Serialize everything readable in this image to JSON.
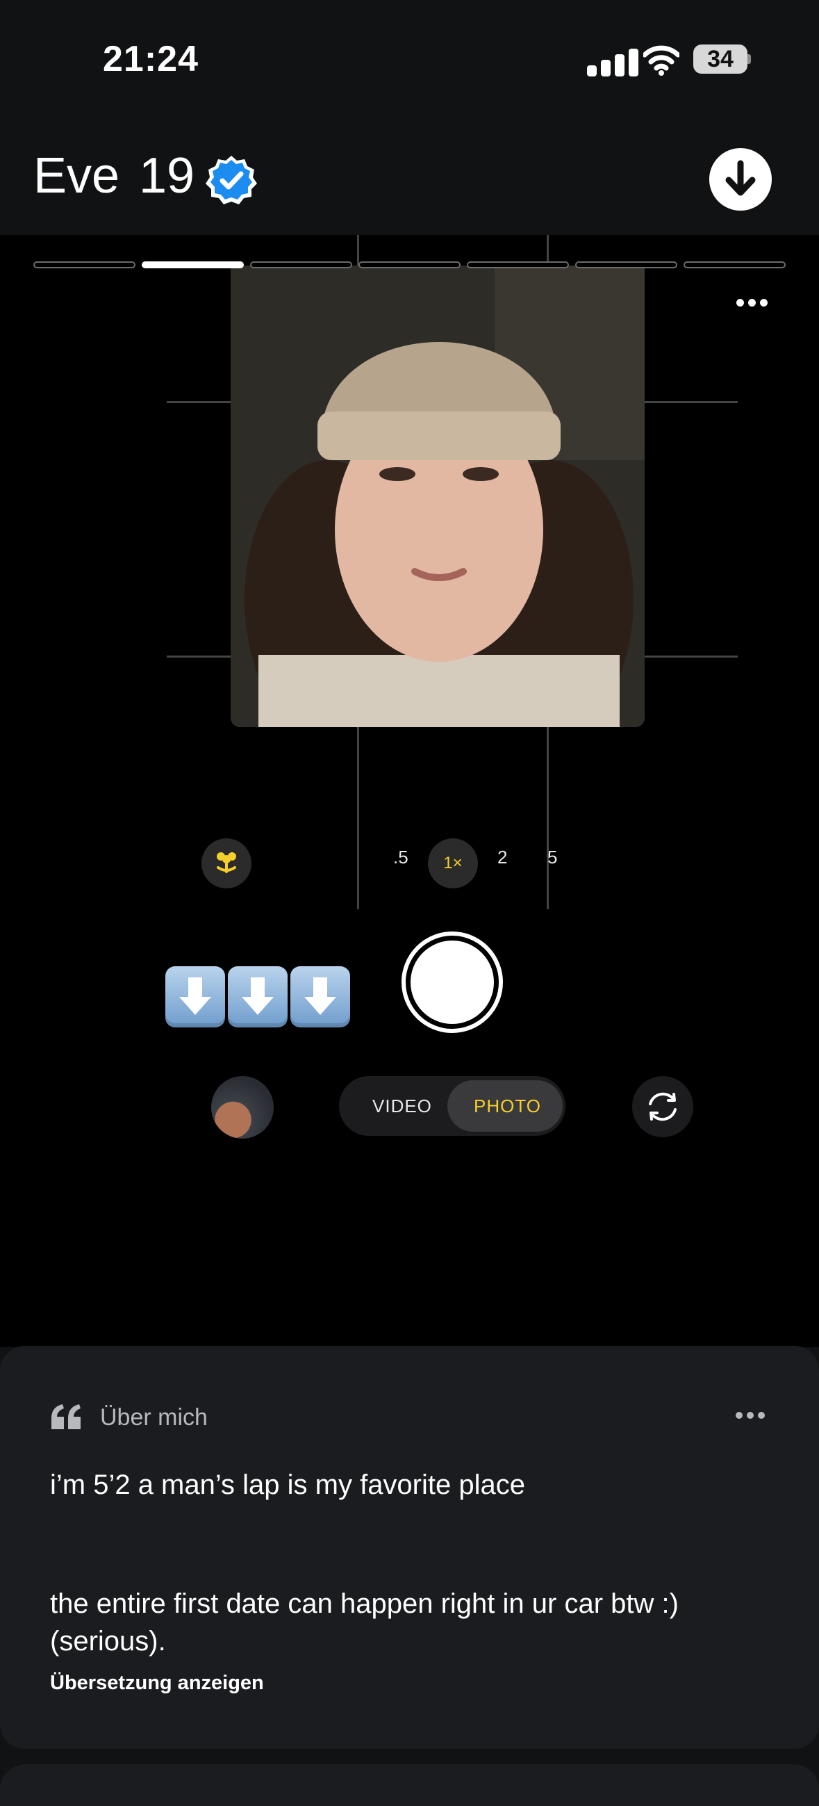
{
  "status_bar": {
    "time": "21:24",
    "battery": "34"
  },
  "profile": {
    "name": "Eve",
    "age": "19",
    "verified": true
  },
  "photos": {
    "count": 7,
    "active_index": 1
  },
  "camera_ui": {
    "zoom_levels": [
      ".5",
      "1×",
      "2",
      "5"
    ],
    "active_zoom": "1×",
    "modes": [
      "VIDEO",
      "PHOTO"
    ],
    "active_mode": "PHOTO"
  },
  "about": {
    "title": "Über mich",
    "bio_line1": "i’m 5’2 a man’s lap is my favorite place",
    "bio_line2": "the entire first date can happen right in ur car btw :) (serious).",
    "translate_label": "Übersetzung anzeigen"
  },
  "colors": {
    "background": "#111214",
    "accent_yellow": "#f7cf2a",
    "verified_blue": "#1d8cf0"
  }
}
